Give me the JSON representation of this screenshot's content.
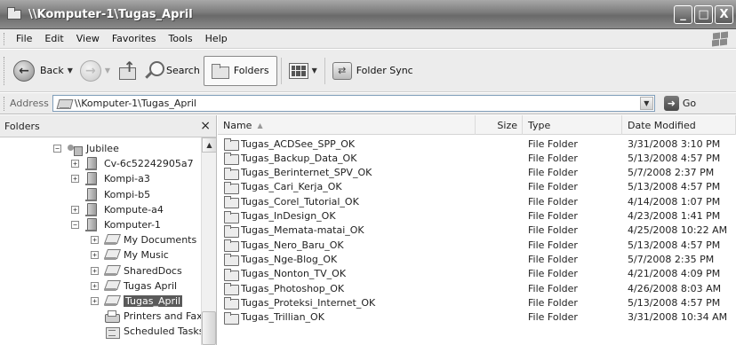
{
  "window": {
    "title": "\\\\Komputer-1\\Tugas_April",
    "controls": {
      "minimize": "_",
      "maximize": "□",
      "close": "X"
    }
  },
  "menu": {
    "items": [
      "File",
      "Edit",
      "View",
      "Favorites",
      "Tools",
      "Help"
    ]
  },
  "toolbar": {
    "back_label": "Back",
    "search_label": "Search",
    "folders_label": "Folders",
    "folder_sync_label": "Folder Sync"
  },
  "address": {
    "label": "Address",
    "value": "\\\\Komputer-1\\Tugas_April",
    "go_label": "Go"
  },
  "folders_pane": {
    "header": "Folders",
    "close": "×",
    "tree": [
      {
        "label": "Jubilee",
        "icon": "network-group-icon",
        "expander": "⊟",
        "indent": 0
      },
      {
        "label": "Cv-6c52242905a7",
        "icon": "computer-icon",
        "expander": "⊞",
        "indent": 1
      },
      {
        "label": "Kompi-a3",
        "icon": "computer-icon",
        "expander": "⊞",
        "indent": 1
      },
      {
        "label": "Kompi-b5",
        "icon": "computer-icon",
        "expander": "",
        "indent": 1
      },
      {
        "label": "Kompute-a4",
        "icon": "computer-icon",
        "expander": "⊞",
        "indent": 1
      },
      {
        "label": "Komputer-1",
        "icon": "computer-icon",
        "expander": "⊟",
        "indent": 1
      },
      {
        "label": "My Documents",
        "icon": "shared-folder-icon",
        "expander": "⊞",
        "indent": 2
      },
      {
        "label": "My Music",
        "icon": "shared-folder-icon",
        "expander": "⊞",
        "indent": 2
      },
      {
        "label": "SharedDocs",
        "icon": "shared-folder-icon",
        "expander": "⊞",
        "indent": 2
      },
      {
        "label": "Tugas April",
        "icon": "shared-folder-icon",
        "expander": "⊞",
        "indent": 2
      },
      {
        "label": "Tugas_April",
        "icon": "shared-folder-icon",
        "expander": "⊞",
        "indent": 2,
        "selected": true
      },
      {
        "label": "Printers and Faxes",
        "icon": "printer-icon",
        "expander": "",
        "indent": 2
      },
      {
        "label": "Scheduled Tasks",
        "icon": "scheduled-tasks-icon",
        "expander": "",
        "indent": 2
      }
    ]
  },
  "file_list": {
    "columns": {
      "name": "Name",
      "size": "Size",
      "type": "Type",
      "date": "Date Modified"
    },
    "rows": [
      {
        "name": "Tugas_ACDSee_SPP_OK",
        "size": "",
        "type": "File Folder",
        "date": "3/31/2008 3:10 PM"
      },
      {
        "name": "Tugas_Backup_Data_OK",
        "size": "",
        "type": "File Folder",
        "date": "5/13/2008 4:57 PM"
      },
      {
        "name": "Tugas_Berinternet_SPV_OK",
        "size": "",
        "type": "File Folder",
        "date": "5/7/2008 2:37 PM"
      },
      {
        "name": "Tugas_Cari_Kerja_OK",
        "size": "",
        "type": "File Folder",
        "date": "5/13/2008 4:57 PM"
      },
      {
        "name": "Tugas_Corel_Tutorial_OK",
        "size": "",
        "type": "File Folder",
        "date": "4/14/2008 1:07 PM"
      },
      {
        "name": "Tugas_InDesign_OK",
        "size": "",
        "type": "File Folder",
        "date": "4/23/2008 1:41 PM"
      },
      {
        "name": "Tugas_Memata-matai_OK",
        "size": "",
        "type": "File Folder",
        "date": "4/25/2008 10:22 AM"
      },
      {
        "name": "Tugas_Nero_Baru_OK",
        "size": "",
        "type": "File Folder",
        "date": "5/13/2008 4:57 PM"
      },
      {
        "name": "Tugas_Nge-Blog_OK",
        "size": "",
        "type": "File Folder",
        "date": "5/7/2008 2:35 PM"
      },
      {
        "name": "Tugas_Nonton_TV_OK",
        "size": "",
        "type": "File Folder",
        "date": "4/21/2008 4:09 PM"
      },
      {
        "name": "Tugas_Photoshop_OK",
        "size": "",
        "type": "File Folder",
        "date": "4/26/2008 8:03 AM"
      },
      {
        "name": "Tugas_Proteksi_Internet_OK",
        "size": "",
        "type": "File Folder",
        "date": "5/13/2008 4:57 PM"
      },
      {
        "name": "Tugas_Trillian_OK",
        "size": "",
        "type": "File Folder",
        "date": "3/31/2008 10:34 AM"
      }
    ]
  }
}
